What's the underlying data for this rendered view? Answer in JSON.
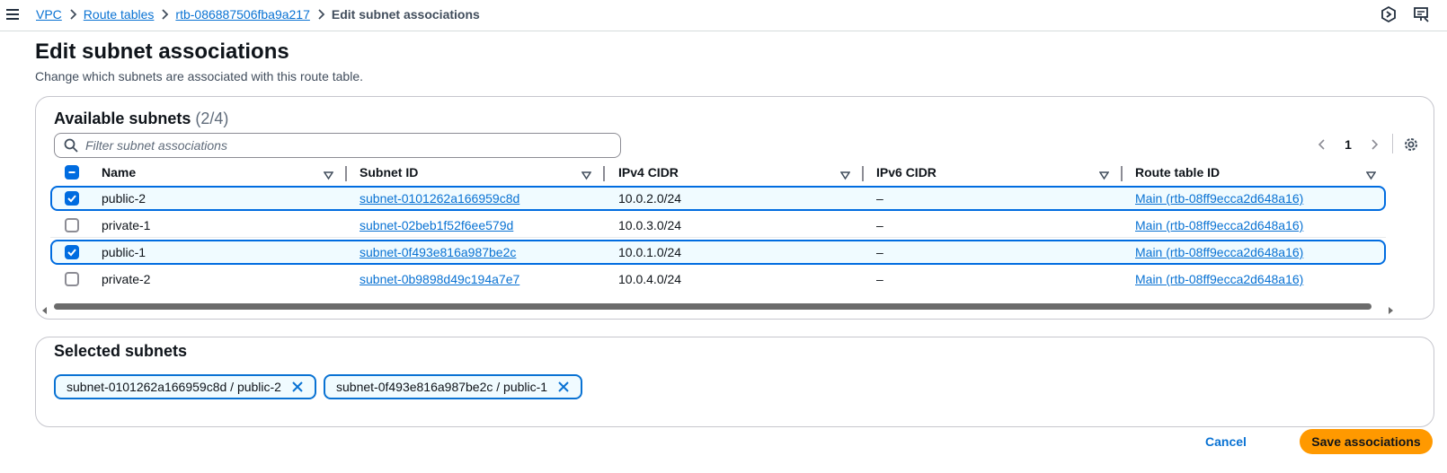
{
  "breadcrumb": {
    "items": [
      "VPC",
      "Route tables",
      "rtb-086887506fba9a217"
    ],
    "current": "Edit subnet associations"
  },
  "page": {
    "title": "Edit subnet associations",
    "description": "Change which subnets are associated with this route table."
  },
  "available": {
    "title": "Available subnets",
    "count": "(2/4)",
    "filter_placeholder": "Filter subnet associations",
    "page_number": "1",
    "columns": [
      "Name",
      "Subnet ID",
      "IPv4 CIDR",
      "IPv6 CIDR",
      "Route table ID"
    ],
    "rows": [
      {
        "name": "public-2",
        "subnet_id": "subnet-0101262a166959c8d",
        "ipv4": "10.0.2.0/24",
        "ipv6": "–",
        "route_table": "Main (rtb-08ff9ecca2d648a16)",
        "selected": true
      },
      {
        "name": "private-1",
        "subnet_id": "subnet-02beb1f52f6ee579d",
        "ipv4": "10.0.3.0/24",
        "ipv6": "–",
        "route_table": "Main (rtb-08ff9ecca2d648a16)",
        "selected": false
      },
      {
        "name": "public-1",
        "subnet_id": "subnet-0f493e816a987be2c",
        "ipv4": "10.0.1.0/24",
        "ipv6": "–",
        "route_table": "Main (rtb-08ff9ecca2d648a16)",
        "selected": true
      },
      {
        "name": "private-2",
        "subnet_id": "subnet-0b9898d49c194a7e7",
        "ipv4": "10.0.4.0/24",
        "ipv6": "–",
        "route_table": "Main (rtb-08ff9ecca2d648a16)",
        "selected": false
      }
    ]
  },
  "selected": {
    "title": "Selected subnets",
    "tokens": [
      "subnet-0101262a166959c8d / public-2",
      "subnet-0f493e816a987be2c / public-1"
    ]
  },
  "actions": {
    "cancel": "Cancel",
    "save": "Save associations"
  },
  "colors": {
    "link": "#0972d3",
    "primary_button": "#ff9900",
    "selected_row_border": "#006ce0",
    "selected_row_bg": "#f0fbff"
  }
}
